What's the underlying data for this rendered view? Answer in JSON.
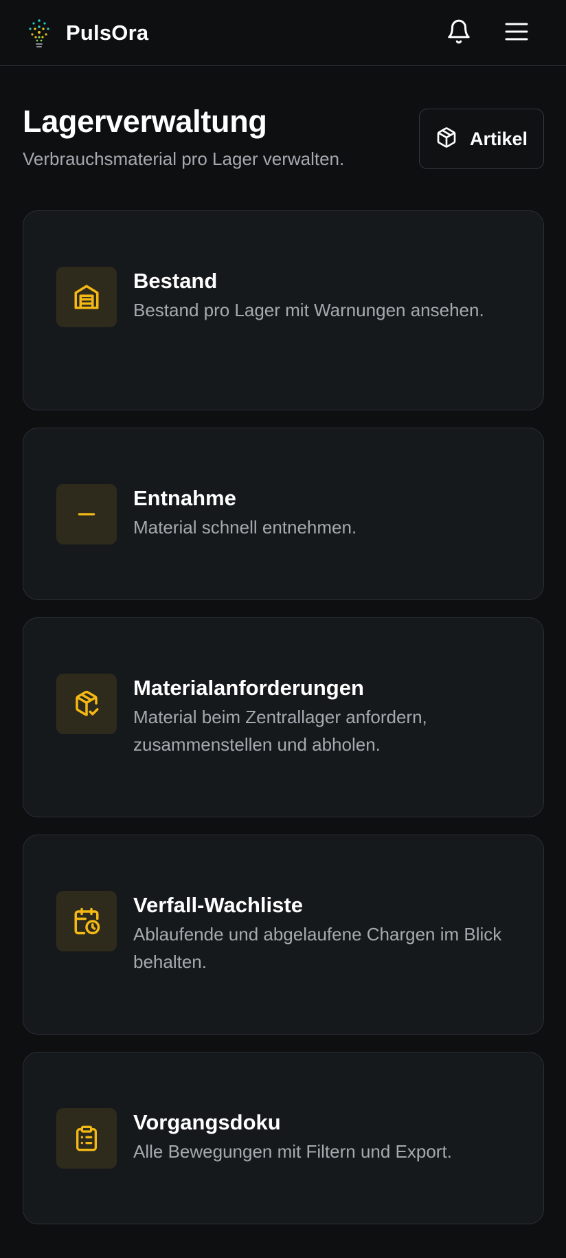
{
  "app": {
    "name": "PulsOra",
    "logo_icon": "lightbulb-dots-icon",
    "notifications_icon": "bell-icon",
    "menu_icon": "hamburger-menu-icon"
  },
  "page": {
    "title": "Lagerverwaltung",
    "subtitle": "Verbrauchsmaterial pro Lager verwalten."
  },
  "actions": {
    "artikel_label": "Artikel",
    "artikel_icon": "cube-icon"
  },
  "colors": {
    "background": "#0d0f11",
    "card": "#16191c",
    "accent": "#f5b916",
    "icon_tile": "#2e2b1c",
    "muted_text": "#a6aab0"
  },
  "cards": [
    {
      "title": "Bestand",
      "description": "Bestand pro Lager mit Warnungen ansehen.",
      "icon": "warehouse-icon"
    },
    {
      "title": "Entnahme",
      "description": "Material schnell entnehmen.",
      "icon": "minus-icon"
    },
    {
      "title": "Materialanforderungen",
      "description": "Material beim Zentrallager anfordern, zusammenstellen und abholen.",
      "icon": "package-check-icon"
    },
    {
      "title": "Verfall-Wachliste",
      "description": "Ablaufende und abgelaufene Chargen im Blick behalten.",
      "icon": "calendar-clock-icon"
    },
    {
      "title": "Vorgangsdoku",
      "description": "Alle Bewegungen mit Filtern und Export.",
      "icon": "clipboard-list-icon"
    }
  ]
}
